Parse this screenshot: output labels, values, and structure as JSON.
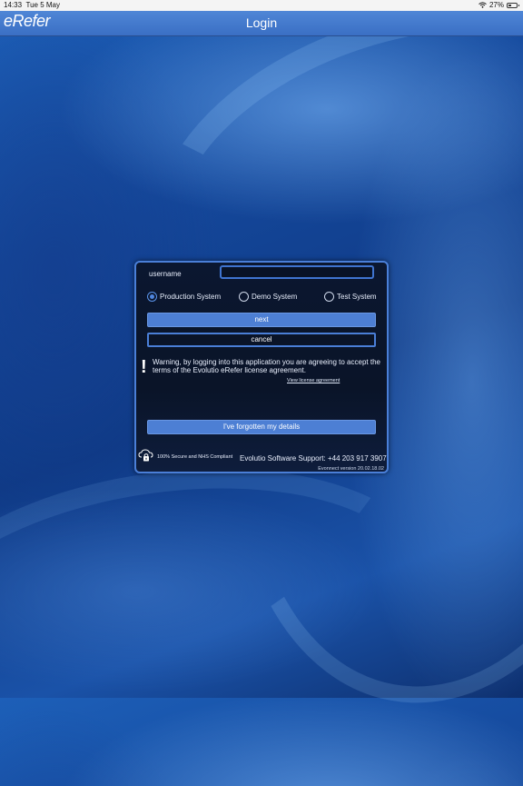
{
  "status_bar": {
    "time": "14:33",
    "date": "Tue 5 May",
    "battery": "27%"
  },
  "nav_bar": {
    "logo": "eRefer",
    "title": "Login"
  },
  "login": {
    "username_label": "username",
    "username_value": "",
    "systems": [
      {
        "label": "Production System",
        "selected": true
      },
      {
        "label": "Demo System",
        "selected": false
      },
      {
        "label": "Test System",
        "selected": false
      }
    ],
    "next_label": "next",
    "cancel_label": "cancel",
    "warning_text": "Warning, by logging into this application you are agreeing to accept the terms of the Evolutio eRefer license agreement.",
    "license_link": "View license agreement",
    "forgot_label": "I've forgotten my details",
    "secure_text": "100% Secure and NHS Compliant",
    "support_text": "Evolutio Software Support: +44 203 917 3907",
    "version_text": "Evonnect version 20.02.18.02"
  },
  "colors": {
    "accent": "#4d7fd4",
    "nav_bar": "#3a6fc4",
    "dialog_bg": "#0a1428"
  }
}
